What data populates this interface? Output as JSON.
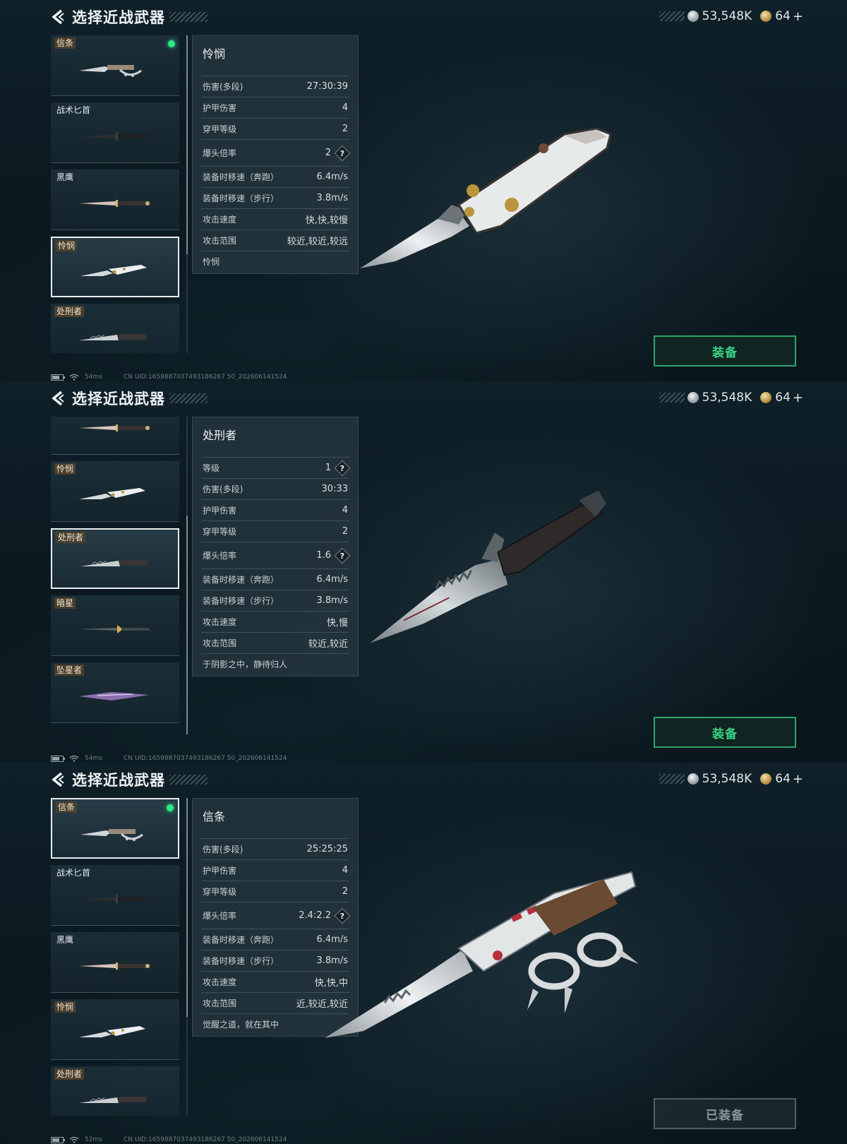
{
  "header": {
    "title": "选择近战武器"
  },
  "currency": {
    "silver": "53,548K",
    "gold": "64",
    "plus": "+"
  },
  "equip": {
    "label": "装备",
    "equipped_label": "已装备"
  },
  "footer": {
    "ping1": "54ms",
    "ping2": "54ms",
    "ping3": "52ms",
    "uid": "CN UID:1659887037493186267 50_202606141524"
  },
  "icons": [
    "back-arrow-icon",
    "silver-coin-icon",
    "gold-coin-icon",
    "plus-icon",
    "help-icon",
    "battery-icon",
    "wifi-icon",
    "equipped-dot-icon"
  ],
  "colors": {
    "accent_green": "#38d585",
    "equipped_dot": "#2ee88a",
    "background": "#0c1a21"
  },
  "screens": [
    {
      "list": [
        {
          "label": "信条",
          "tag": true,
          "equipped": true
        },
        {
          "label": "战术匕首"
        },
        {
          "label": "黑鹰"
        },
        {
          "label": "怜悯",
          "tag": true,
          "selected": true
        },
        {
          "label": "处刑者",
          "tag": true
        }
      ],
      "panel": {
        "title": "怜悯",
        "stats": [
          {
            "label": "伤害(多段)",
            "value": "27:30:39"
          },
          {
            "label": "护甲伤害",
            "value": "4"
          },
          {
            "label": "穿甲等级",
            "value": "2"
          },
          {
            "label": "爆头倍率",
            "value": "2",
            "help": true
          },
          {
            "label": "装备时移速（奔跑）",
            "value": "6.4m/s"
          },
          {
            "label": "装备时移速（步行）",
            "value": "3.8m/s"
          },
          {
            "label": "攻击速度",
            "value": "快,快,较慢"
          },
          {
            "label": "攻击范围",
            "value": "较近,较近,较远"
          }
        ],
        "description": "怜悯"
      }
    },
    {
      "list": [
        {
          "label": ""
        },
        {
          "label": "怜悯",
          "tag": true
        },
        {
          "label": "处刑者",
          "tag": true,
          "selected": true
        },
        {
          "label": "暗星",
          "tag": true
        },
        {
          "label": "坠星者",
          "tag": true
        }
      ],
      "panel": {
        "title": "处刑者",
        "stats": [
          {
            "label": "等级",
            "value": "1",
            "help": true
          },
          {
            "label": "伤害(多段)",
            "value": "30:33"
          },
          {
            "label": "护甲伤害",
            "value": "4"
          },
          {
            "label": "穿甲等级",
            "value": "2"
          },
          {
            "label": "爆头倍率",
            "value": "1.6",
            "help": true
          },
          {
            "label": "装备时移速（奔跑）",
            "value": "6.4m/s"
          },
          {
            "label": "装备时移速（步行）",
            "value": "3.8m/s"
          },
          {
            "label": "攻击速度",
            "value": "快,慢"
          },
          {
            "label": "攻击范围",
            "value": "较近,较近"
          }
        ],
        "description": "于阴影之中，静待归人"
      }
    },
    {
      "list": [
        {
          "label": "信条",
          "tag": true,
          "equipped": true,
          "selected": true
        },
        {
          "label": "战术匕首"
        },
        {
          "label": "黑鹰"
        },
        {
          "label": "怜悯",
          "tag": true
        },
        {
          "label": "处刑者",
          "tag": true
        }
      ],
      "panel": {
        "title": "信条",
        "stats": [
          {
            "label": "伤害(多段)",
            "value": "25:25:25"
          },
          {
            "label": "护甲伤害",
            "value": "4"
          },
          {
            "label": "穿甲等级",
            "value": "2"
          },
          {
            "label": "爆头倍率",
            "value": "2.4:2.2",
            "help": true
          },
          {
            "label": "装备时移速（奔跑）",
            "value": "6.4m/s"
          },
          {
            "label": "装备时移速（步行）",
            "value": "3.8m/s"
          },
          {
            "label": "攻击速度",
            "value": "快,快,中"
          },
          {
            "label": "攻击范围",
            "value": "近,较近,较近"
          }
        ],
        "description": "觉醒之道，就在其中"
      }
    }
  ]
}
